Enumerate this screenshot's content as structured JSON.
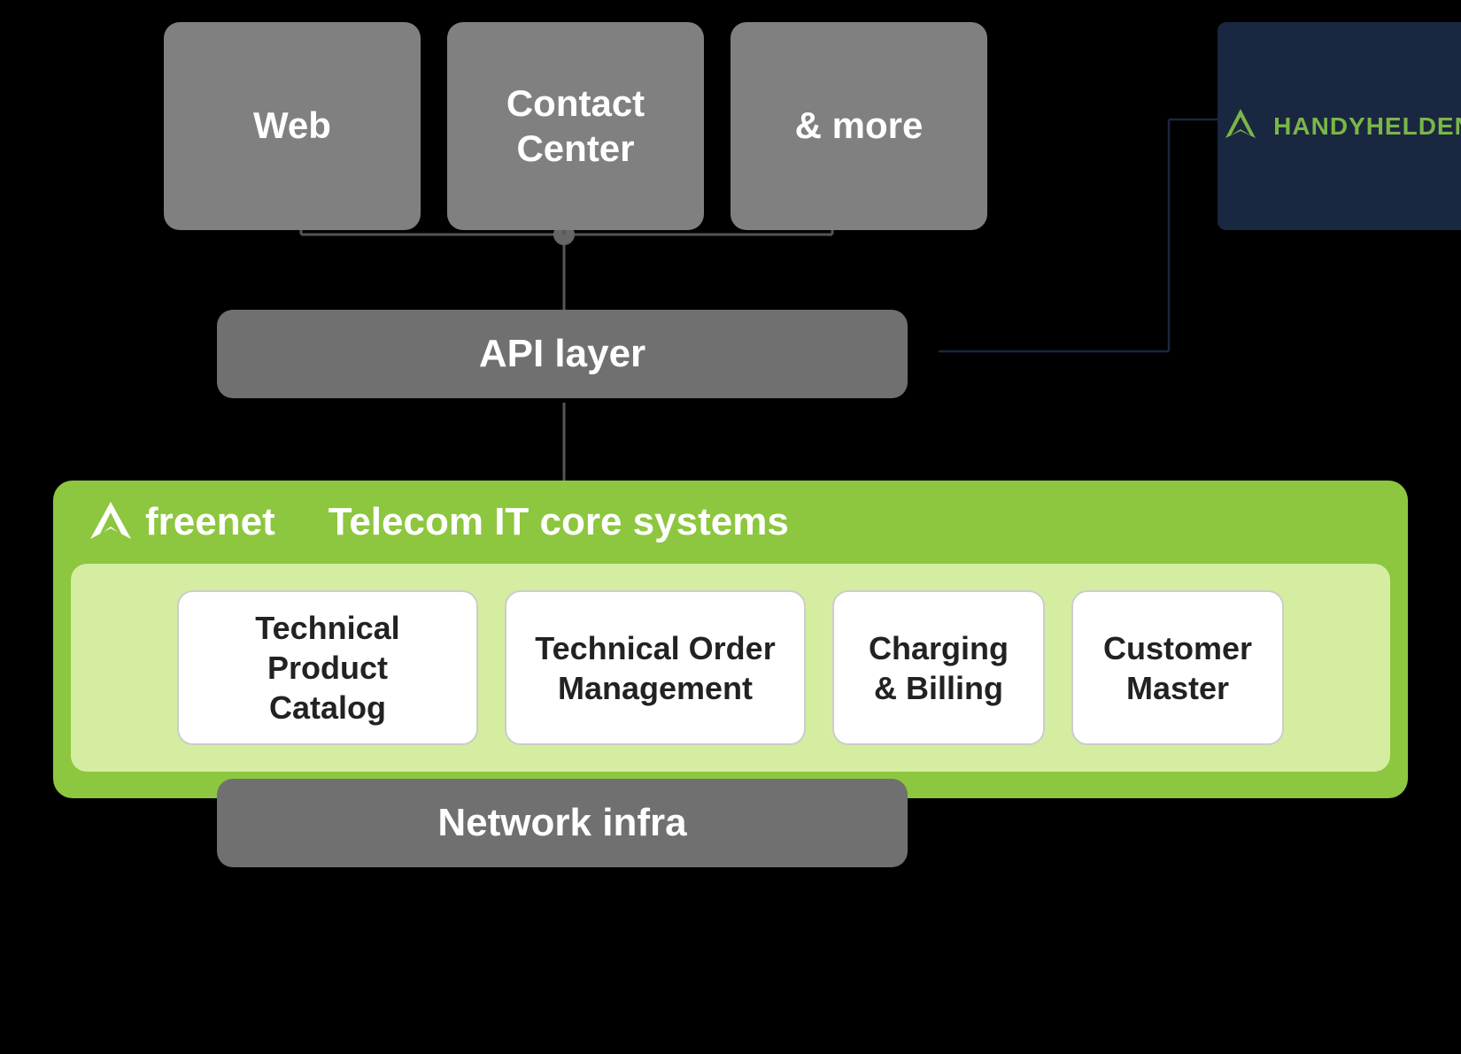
{
  "channels": {
    "web": {
      "label": "Web"
    },
    "contactCenter": {
      "label": "Contact\nCenter"
    },
    "more": {
      "label": "& more"
    }
  },
  "handyhelden": {
    "name": "HANDYHELDEN",
    "iconColor": "#7ab648"
  },
  "apiLayer": {
    "label": "API layer"
  },
  "freenet": {
    "logoText": "freenet",
    "coreSystemsTitle": "Telecom IT core systems"
  },
  "coreSystems": [
    {
      "id": "technical-product-catalog",
      "label": "Technical Product\nCatalog"
    },
    {
      "id": "technical-order-management",
      "label": "Technical Order\nManagement"
    },
    {
      "id": "charging-billing",
      "label": "Charging\n& Billing"
    },
    {
      "id": "customer-master",
      "label": "Customer\nMaster"
    }
  ],
  "networkInfra": {
    "label": "Network infra"
  }
}
